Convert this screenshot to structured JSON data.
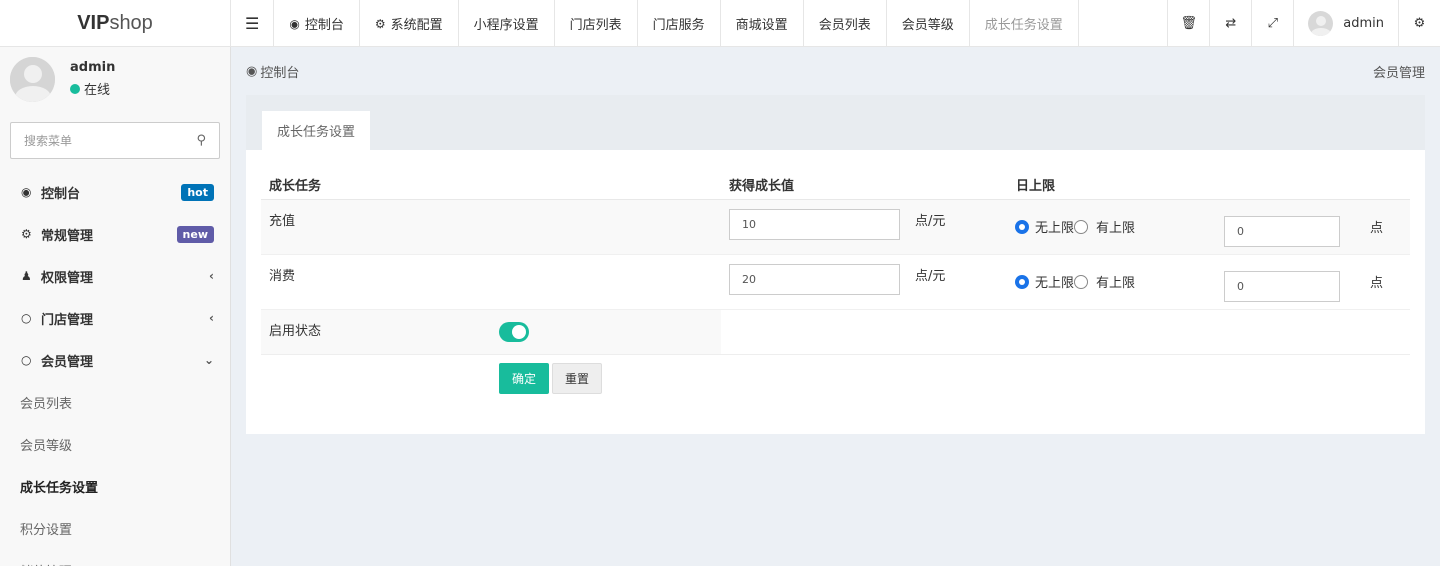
{
  "header": {
    "logo_bold": "VIP",
    "logo_light": "shop",
    "nav": [
      {
        "label": "控制台",
        "icon": "dashboard-icon"
      },
      {
        "label": "系统配置",
        "icon": "gear-icon"
      },
      {
        "label": "小程序设置"
      },
      {
        "label": "门店列表"
      },
      {
        "label": "门店服务"
      },
      {
        "label": "商城设置"
      },
      {
        "label": "会员列表"
      },
      {
        "label": "会员等级"
      },
      {
        "label": "成长任务设置"
      }
    ],
    "user_name": "admin"
  },
  "sidebar": {
    "user_name": "admin",
    "status": "在线",
    "search_placeholder": "搜索菜单",
    "menu": [
      {
        "label": "控制台",
        "badge": "hot",
        "badge_color": "#0073b7"
      },
      {
        "label": "常规管理",
        "badge": "new",
        "badge_color": "#605ca8"
      },
      {
        "label": "权限管理"
      },
      {
        "label": "门店管理"
      },
      {
        "label": "会员管理"
      }
    ],
    "submenu": [
      {
        "label": "会员列表"
      },
      {
        "label": "会员等级"
      },
      {
        "label": "成长任务设置"
      },
      {
        "label": "积分设置"
      },
      {
        "label": "储值管理"
      }
    ]
  },
  "breadcrumb": {
    "current": "控制台",
    "right": "会员管理"
  },
  "panel": {
    "tab": "成长任务设置",
    "columns": [
      "成长任务",
      "获得成长值",
      "日上限"
    ],
    "rows": [
      {
        "name": "充值",
        "value": "10",
        "unit": "点/元",
        "opt_unlimited": "无上限",
        "opt_limited": "有上限",
        "limit": "0",
        "limit_unit": "点"
      },
      {
        "name": "消费",
        "value": "20",
        "unit": "点/元",
        "opt_unlimited": "无上限",
        "opt_limited": "有上限",
        "limit": "0",
        "limit_unit": "点"
      }
    ],
    "status_label": "启用状态",
    "ok_label": "确定",
    "reset_label": "重置"
  },
  "colors": {
    "accent": "#18bc9c",
    "radio": "#1a73e8"
  }
}
